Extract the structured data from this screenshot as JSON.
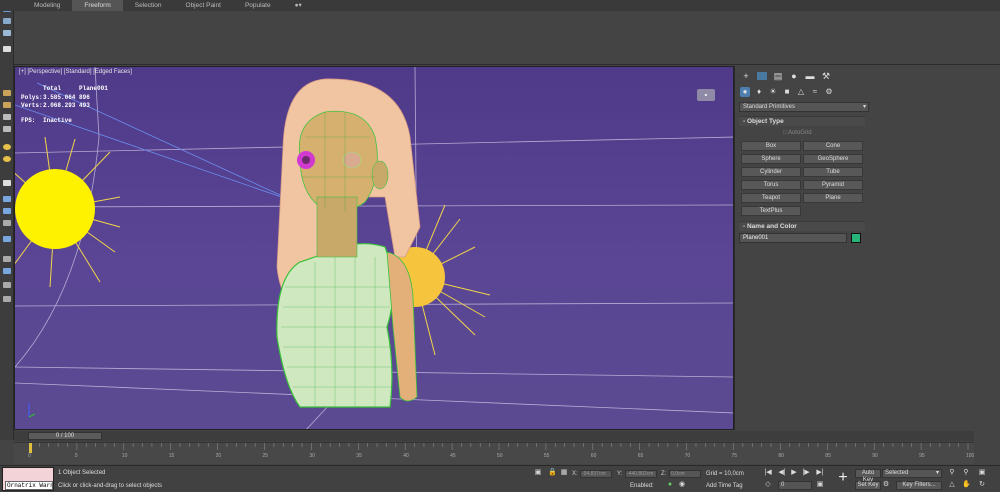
{
  "ribbon": {
    "tabs": [
      "Modeling",
      "Freeform",
      "Selection",
      "Object Paint",
      "Populate"
    ],
    "active_tab": "Freeform"
  },
  "viewport": {
    "label": "[+] [Perspective] [Standard] [Edged Faces]",
    "stats": {
      "header_total": "Total",
      "header_object": "Plane001",
      "polys_label": "Polys:",
      "polys_total": "3.585.064",
      "polys_object": "896",
      "verts_label": "Verts:",
      "verts_total": "2.068.293",
      "verts_object": "493",
      "fps_label": "FPS:",
      "fps_value": "Inactive"
    },
    "background_color": "#543f8f"
  },
  "command_panel": {
    "category_dropdown": "Standard Primitives",
    "object_type_title": "Object Type",
    "autogrid_label": "AutoGrid",
    "primitives": [
      "Box",
      "Cone",
      "Sphere",
      "GeoSphere",
      "Cylinder",
      "Tube",
      "Torus",
      "Pyramid",
      "Teapot",
      "Plane",
      "TextPlus"
    ],
    "name_color_title": "Name and Color",
    "object_name": "Plane001",
    "object_color": "#26b47a"
  },
  "timeline": {
    "current": "0 / 100",
    "ticks": [
      "0",
      "5",
      "10",
      "15",
      "20",
      "25",
      "30",
      "35",
      "40",
      "45",
      "50",
      "55",
      "60",
      "65",
      "70",
      "75",
      "80",
      "85",
      "90",
      "95",
      "100"
    ]
  },
  "status": {
    "maxscript_value": "Ornatrix Warn",
    "selection_info": "1 Object Selected",
    "prompt": "Click or click-and-drag to select objects",
    "x_label": "X:",
    "x_value": "-94,837cm",
    "y_label": "Y:",
    "y_value": "-440,802cm",
    "z_label": "Z:",
    "z_value": "0,0cm",
    "grid": "Grid = 10,0cm",
    "enabled_label": "Enabled:",
    "add_time_tag": "Add Time Tag",
    "auto_key": "Auto Key",
    "set_key": "Set Key",
    "selected_dropdown": "Selected",
    "key_filters": "Key Filters...",
    "frame_value": "0"
  }
}
